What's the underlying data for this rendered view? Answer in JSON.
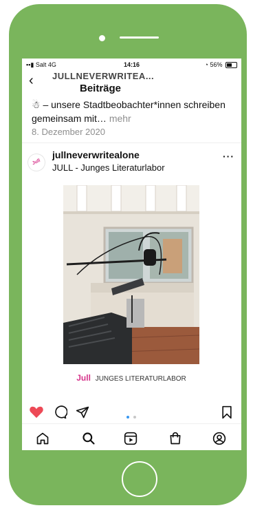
{
  "status_bar": {
    "carrier": "Salt",
    "network": "4G",
    "time": "14:16",
    "battery": "56%",
    "battery_level": 0.56
  },
  "header": {
    "account": "JULLNEVERWRITEA...",
    "title": "Beiträge"
  },
  "post_caption": {
    "text": "– unsere Stadtbeobachter*innen schreiben gemeinsam mit…",
    "more": "mehr",
    "date": "8. Dezember 2020"
  },
  "post": {
    "avatar_text": "Jull",
    "username": "jullneverwritealone",
    "subtitle": "JULL - Junges Literaturlabor",
    "more": "···"
  },
  "image_brand": {
    "logo": "Jull",
    "text": "JUNGES LITERATURLABOR"
  },
  "colors": {
    "phone_frame": "#7ab55c",
    "like_active": "#ed4956",
    "carousel_dot_active": "#3897f0",
    "brand_pink": "#d6338a"
  },
  "actions": {
    "icons": [
      "heart-icon",
      "comment-icon",
      "share-icon",
      "bookmark-icon"
    ],
    "carousel_pages": 2,
    "carousel_active": 1
  },
  "nav": {
    "icons": [
      "home-icon",
      "search-icon",
      "reels-icon",
      "shop-icon",
      "profile-icon"
    ]
  }
}
